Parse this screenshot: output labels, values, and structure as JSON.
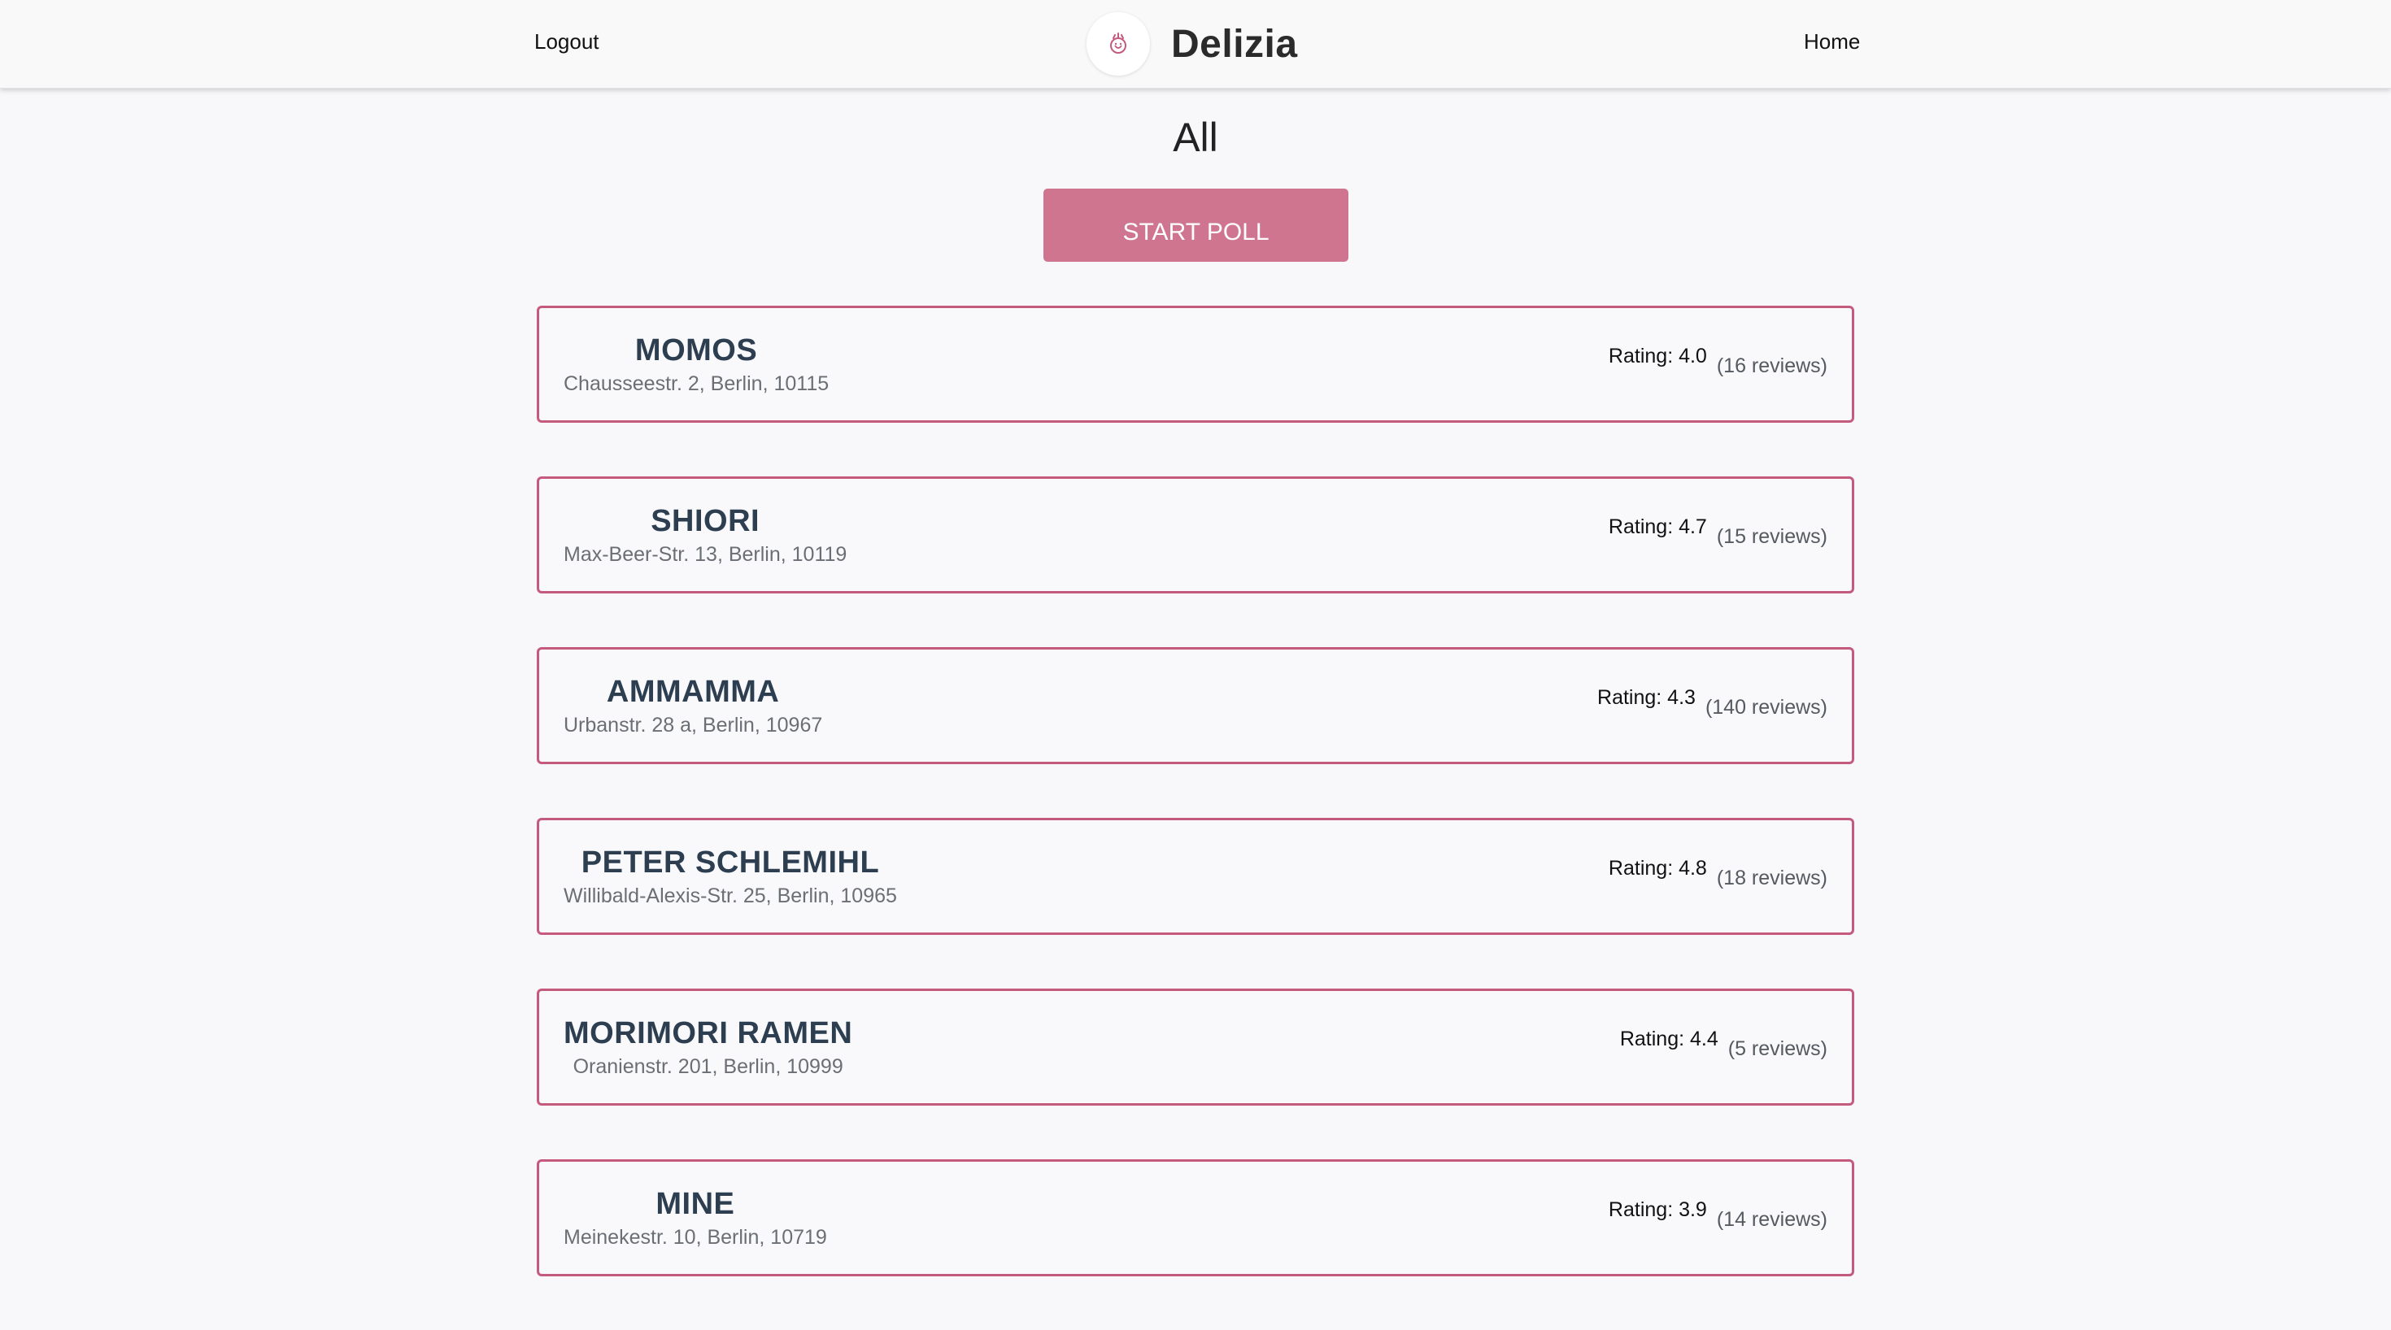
{
  "nav": {
    "logout_label": "Logout",
    "home_label": "Home",
    "brand_name": "Delizia",
    "logo_icon": "pink-logo-icon"
  },
  "page": {
    "title": "All",
    "start_poll_label": "START POLL"
  },
  "colors": {
    "accent": "#cf758f",
    "card_border": "#c45a7c"
  },
  "restaurants": [
    {
      "name": "MOMOS",
      "address": "Chausseestr. 2, Berlin, 10115",
      "rating": "Rating: 4.0",
      "reviews": "(16 reviews)"
    },
    {
      "name": "SHIORI",
      "address": "Max-Beer-Str. 13, Berlin, 10119",
      "rating": "Rating: 4.7",
      "reviews": "(15 reviews)"
    },
    {
      "name": "AMMAMMA",
      "address": "Urbanstr. 28 a, Berlin, 10967",
      "rating": "Rating: 4.3",
      "reviews": "(140 reviews)"
    },
    {
      "name": "PETER SCHLEMIHL",
      "address": "Willibald-Alexis-Str. 25, Berlin, 10965",
      "rating": "Rating: 4.8",
      "reviews": "(18 reviews)"
    },
    {
      "name": "MORIMORI RAMEN",
      "address": "Oranienstr. 201, Berlin, 10999",
      "rating": "Rating: 4.4",
      "reviews": "(5 reviews)"
    },
    {
      "name": "MINE",
      "address": "Meinekestr. 10, Berlin, 10719",
      "rating": "Rating: 3.9",
      "reviews": "(14 reviews)"
    }
  ]
}
